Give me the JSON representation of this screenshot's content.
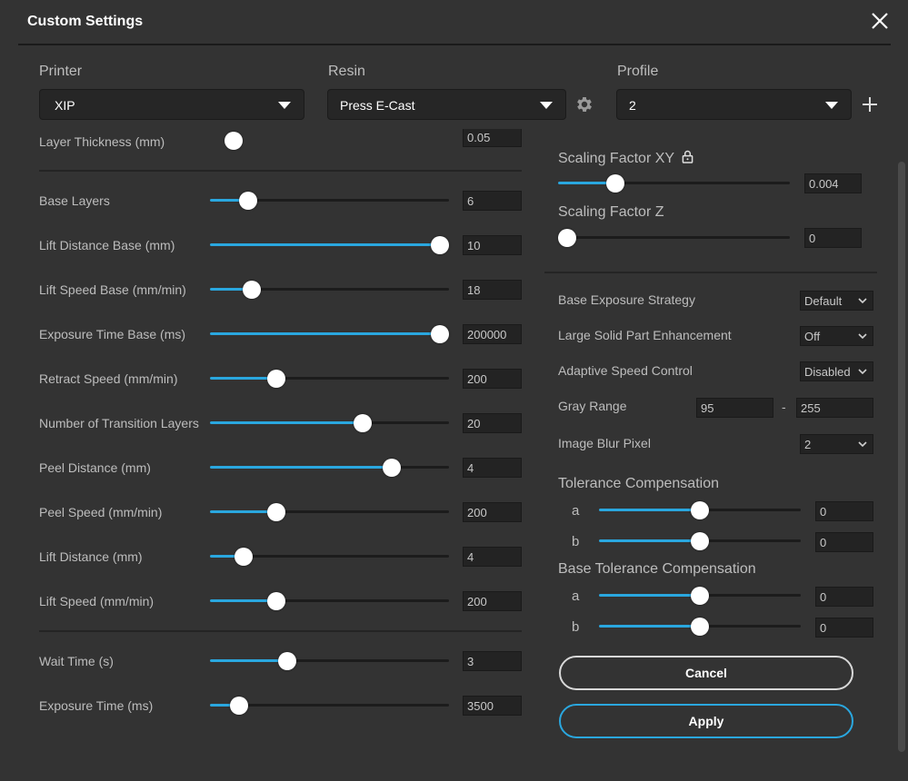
{
  "dialog": {
    "title": "Custom Settings"
  },
  "header": {
    "printer_label": "Printer",
    "printer_value": "XIP",
    "resin_label": "Resin",
    "resin_value": "Press E-Cast",
    "profile_label": "Profile",
    "profile_value": "2"
  },
  "left": {
    "partial_label": "Layer Thickness (mm)",
    "partial_value": "0.05",
    "rows": [
      {
        "label": "Base Layers",
        "value": "6",
        "level": 0.13
      },
      {
        "label": "Lift Distance Base (mm)",
        "value": "10",
        "level": 1.0
      },
      {
        "label": "Lift Speed Base (mm/min)",
        "value": "18",
        "level": 0.15
      },
      {
        "label": "Exposure Time Base (ms)",
        "value": "200000",
        "level": 1.0
      },
      {
        "label": "Retract Speed (mm/min)",
        "value": "200",
        "level": 0.26
      },
      {
        "label": "Number of Transition Layers",
        "value": "20",
        "level": 0.65
      },
      {
        "label": "Peel Distance (mm)",
        "value": "4",
        "level": 0.78
      },
      {
        "label": "Peel Speed (mm/min)",
        "value": "200",
        "level": 0.26
      },
      {
        "label": "Lift Distance (mm)",
        "value": "4",
        "level": 0.11
      },
      {
        "label": "Lift Speed (mm/min)",
        "value": "200",
        "level": 0.26
      }
    ],
    "rows2": [
      {
        "label": "Wait Time (s)",
        "value": "3",
        "level": 0.31
      },
      {
        "label": "Exposure Time (ms)",
        "value": "3500",
        "level": 0.09
      }
    ]
  },
  "right": {
    "scaling_xy_label": "Scaling Factor XY",
    "scaling_xy_value": "0.004",
    "scaling_xy_level": 0.225,
    "scaling_z_label": "Scaling Factor Z",
    "scaling_z_value": "0",
    "scaling_z_level": 0.0,
    "base_exposure_label": "Base Exposure Strategy",
    "base_exposure_value": "Default",
    "large_solid_label": "Large Solid Part Enhancement",
    "large_solid_value": "Off",
    "adaptive_label": "Adaptive Speed Control",
    "adaptive_value": "Disabled",
    "gray_label": "Gray Range",
    "gray_min": "95",
    "gray_dash": "-",
    "gray_max": "255",
    "blur_label": "Image Blur Pixel",
    "blur_value": "2",
    "tol_label": "Tolerance Compensation",
    "tol_a_label": "a",
    "tol_a_value": "0",
    "tol_a_level": 0.5,
    "tol_b_label": "b",
    "tol_b_value": "0",
    "tol_b_level": 0.5,
    "btol_label": "Base Tolerance Compensation",
    "btol_a_label": "a",
    "btol_a_value": "0",
    "btol_a_level": 0.5,
    "btol_b_label": "b",
    "btol_b_value": "0",
    "btol_b_level": 0.5
  },
  "buttons": {
    "cancel": "Cancel",
    "apply": "Apply"
  },
  "colors": {
    "accent": "#2aa7df",
    "background": "#333333",
    "field": "#232323"
  }
}
